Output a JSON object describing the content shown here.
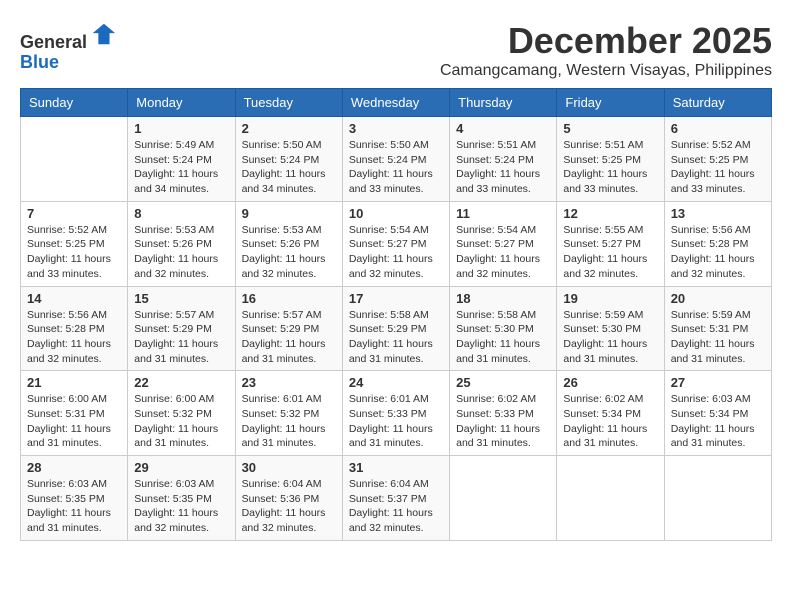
{
  "header": {
    "logo_line1": "General",
    "logo_line2": "Blue",
    "month": "December 2025",
    "location": "Camangcamang, Western Visayas, Philippines"
  },
  "weekdays": [
    "Sunday",
    "Monday",
    "Tuesday",
    "Wednesday",
    "Thursday",
    "Friday",
    "Saturday"
  ],
  "weeks": [
    [
      {
        "day": "",
        "info": ""
      },
      {
        "day": "1",
        "info": "Sunrise: 5:49 AM\nSunset: 5:24 PM\nDaylight: 11 hours\nand 34 minutes."
      },
      {
        "day": "2",
        "info": "Sunrise: 5:50 AM\nSunset: 5:24 PM\nDaylight: 11 hours\nand 34 minutes."
      },
      {
        "day": "3",
        "info": "Sunrise: 5:50 AM\nSunset: 5:24 PM\nDaylight: 11 hours\nand 33 minutes."
      },
      {
        "day": "4",
        "info": "Sunrise: 5:51 AM\nSunset: 5:24 PM\nDaylight: 11 hours\nand 33 minutes."
      },
      {
        "day": "5",
        "info": "Sunrise: 5:51 AM\nSunset: 5:25 PM\nDaylight: 11 hours\nand 33 minutes."
      },
      {
        "day": "6",
        "info": "Sunrise: 5:52 AM\nSunset: 5:25 PM\nDaylight: 11 hours\nand 33 minutes."
      }
    ],
    [
      {
        "day": "7",
        "info": "Sunrise: 5:52 AM\nSunset: 5:25 PM\nDaylight: 11 hours\nand 33 minutes."
      },
      {
        "day": "8",
        "info": "Sunrise: 5:53 AM\nSunset: 5:26 PM\nDaylight: 11 hours\nand 32 minutes."
      },
      {
        "day": "9",
        "info": "Sunrise: 5:53 AM\nSunset: 5:26 PM\nDaylight: 11 hours\nand 32 minutes."
      },
      {
        "day": "10",
        "info": "Sunrise: 5:54 AM\nSunset: 5:27 PM\nDaylight: 11 hours\nand 32 minutes."
      },
      {
        "day": "11",
        "info": "Sunrise: 5:54 AM\nSunset: 5:27 PM\nDaylight: 11 hours\nand 32 minutes."
      },
      {
        "day": "12",
        "info": "Sunrise: 5:55 AM\nSunset: 5:27 PM\nDaylight: 11 hours\nand 32 minutes."
      },
      {
        "day": "13",
        "info": "Sunrise: 5:56 AM\nSunset: 5:28 PM\nDaylight: 11 hours\nand 32 minutes."
      }
    ],
    [
      {
        "day": "14",
        "info": "Sunrise: 5:56 AM\nSunset: 5:28 PM\nDaylight: 11 hours\nand 32 minutes."
      },
      {
        "day": "15",
        "info": "Sunrise: 5:57 AM\nSunset: 5:29 PM\nDaylight: 11 hours\nand 31 minutes."
      },
      {
        "day": "16",
        "info": "Sunrise: 5:57 AM\nSunset: 5:29 PM\nDaylight: 11 hours\nand 31 minutes."
      },
      {
        "day": "17",
        "info": "Sunrise: 5:58 AM\nSunset: 5:29 PM\nDaylight: 11 hours\nand 31 minutes."
      },
      {
        "day": "18",
        "info": "Sunrise: 5:58 AM\nSunset: 5:30 PM\nDaylight: 11 hours\nand 31 minutes."
      },
      {
        "day": "19",
        "info": "Sunrise: 5:59 AM\nSunset: 5:30 PM\nDaylight: 11 hours\nand 31 minutes."
      },
      {
        "day": "20",
        "info": "Sunrise: 5:59 AM\nSunset: 5:31 PM\nDaylight: 11 hours\nand 31 minutes."
      }
    ],
    [
      {
        "day": "21",
        "info": "Sunrise: 6:00 AM\nSunset: 5:31 PM\nDaylight: 11 hours\nand 31 minutes."
      },
      {
        "day": "22",
        "info": "Sunrise: 6:00 AM\nSunset: 5:32 PM\nDaylight: 11 hours\nand 31 minutes."
      },
      {
        "day": "23",
        "info": "Sunrise: 6:01 AM\nSunset: 5:32 PM\nDaylight: 11 hours\nand 31 minutes."
      },
      {
        "day": "24",
        "info": "Sunrise: 6:01 AM\nSunset: 5:33 PM\nDaylight: 11 hours\nand 31 minutes."
      },
      {
        "day": "25",
        "info": "Sunrise: 6:02 AM\nSunset: 5:33 PM\nDaylight: 11 hours\nand 31 minutes."
      },
      {
        "day": "26",
        "info": "Sunrise: 6:02 AM\nSunset: 5:34 PM\nDaylight: 11 hours\nand 31 minutes."
      },
      {
        "day": "27",
        "info": "Sunrise: 6:03 AM\nSunset: 5:34 PM\nDaylight: 11 hours\nand 31 minutes."
      }
    ],
    [
      {
        "day": "28",
        "info": "Sunrise: 6:03 AM\nSunset: 5:35 PM\nDaylight: 11 hours\nand 31 minutes."
      },
      {
        "day": "29",
        "info": "Sunrise: 6:03 AM\nSunset: 5:35 PM\nDaylight: 11 hours\nand 32 minutes."
      },
      {
        "day": "30",
        "info": "Sunrise: 6:04 AM\nSunset: 5:36 PM\nDaylight: 11 hours\nand 32 minutes."
      },
      {
        "day": "31",
        "info": "Sunrise: 6:04 AM\nSunset: 5:37 PM\nDaylight: 11 hours\nand 32 minutes."
      },
      {
        "day": "",
        "info": ""
      },
      {
        "day": "",
        "info": ""
      },
      {
        "day": "",
        "info": ""
      }
    ]
  ]
}
